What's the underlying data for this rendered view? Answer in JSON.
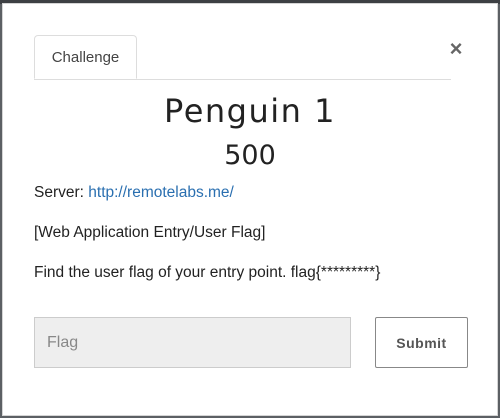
{
  "modal": {
    "tabs": [
      {
        "label": "Challenge",
        "active": true
      }
    ],
    "close_symbol": "×",
    "close_icon": "close-icon"
  },
  "challenge": {
    "name": "Penguin 1",
    "value": "500",
    "server_label": "Server: ",
    "server_link": "http://remotelabs.me/",
    "category_line": "[Web Application Entry/User Flag]",
    "task_line": "Find the user flag of your entry point. flag{*********}"
  },
  "form": {
    "flag_placeholder": "Flag",
    "flag_value": "",
    "submit_label": "Submit"
  },
  "colors": {
    "link": "#2a6fb0",
    "input_bg": "#eeeeee",
    "border": "#dddddd"
  }
}
